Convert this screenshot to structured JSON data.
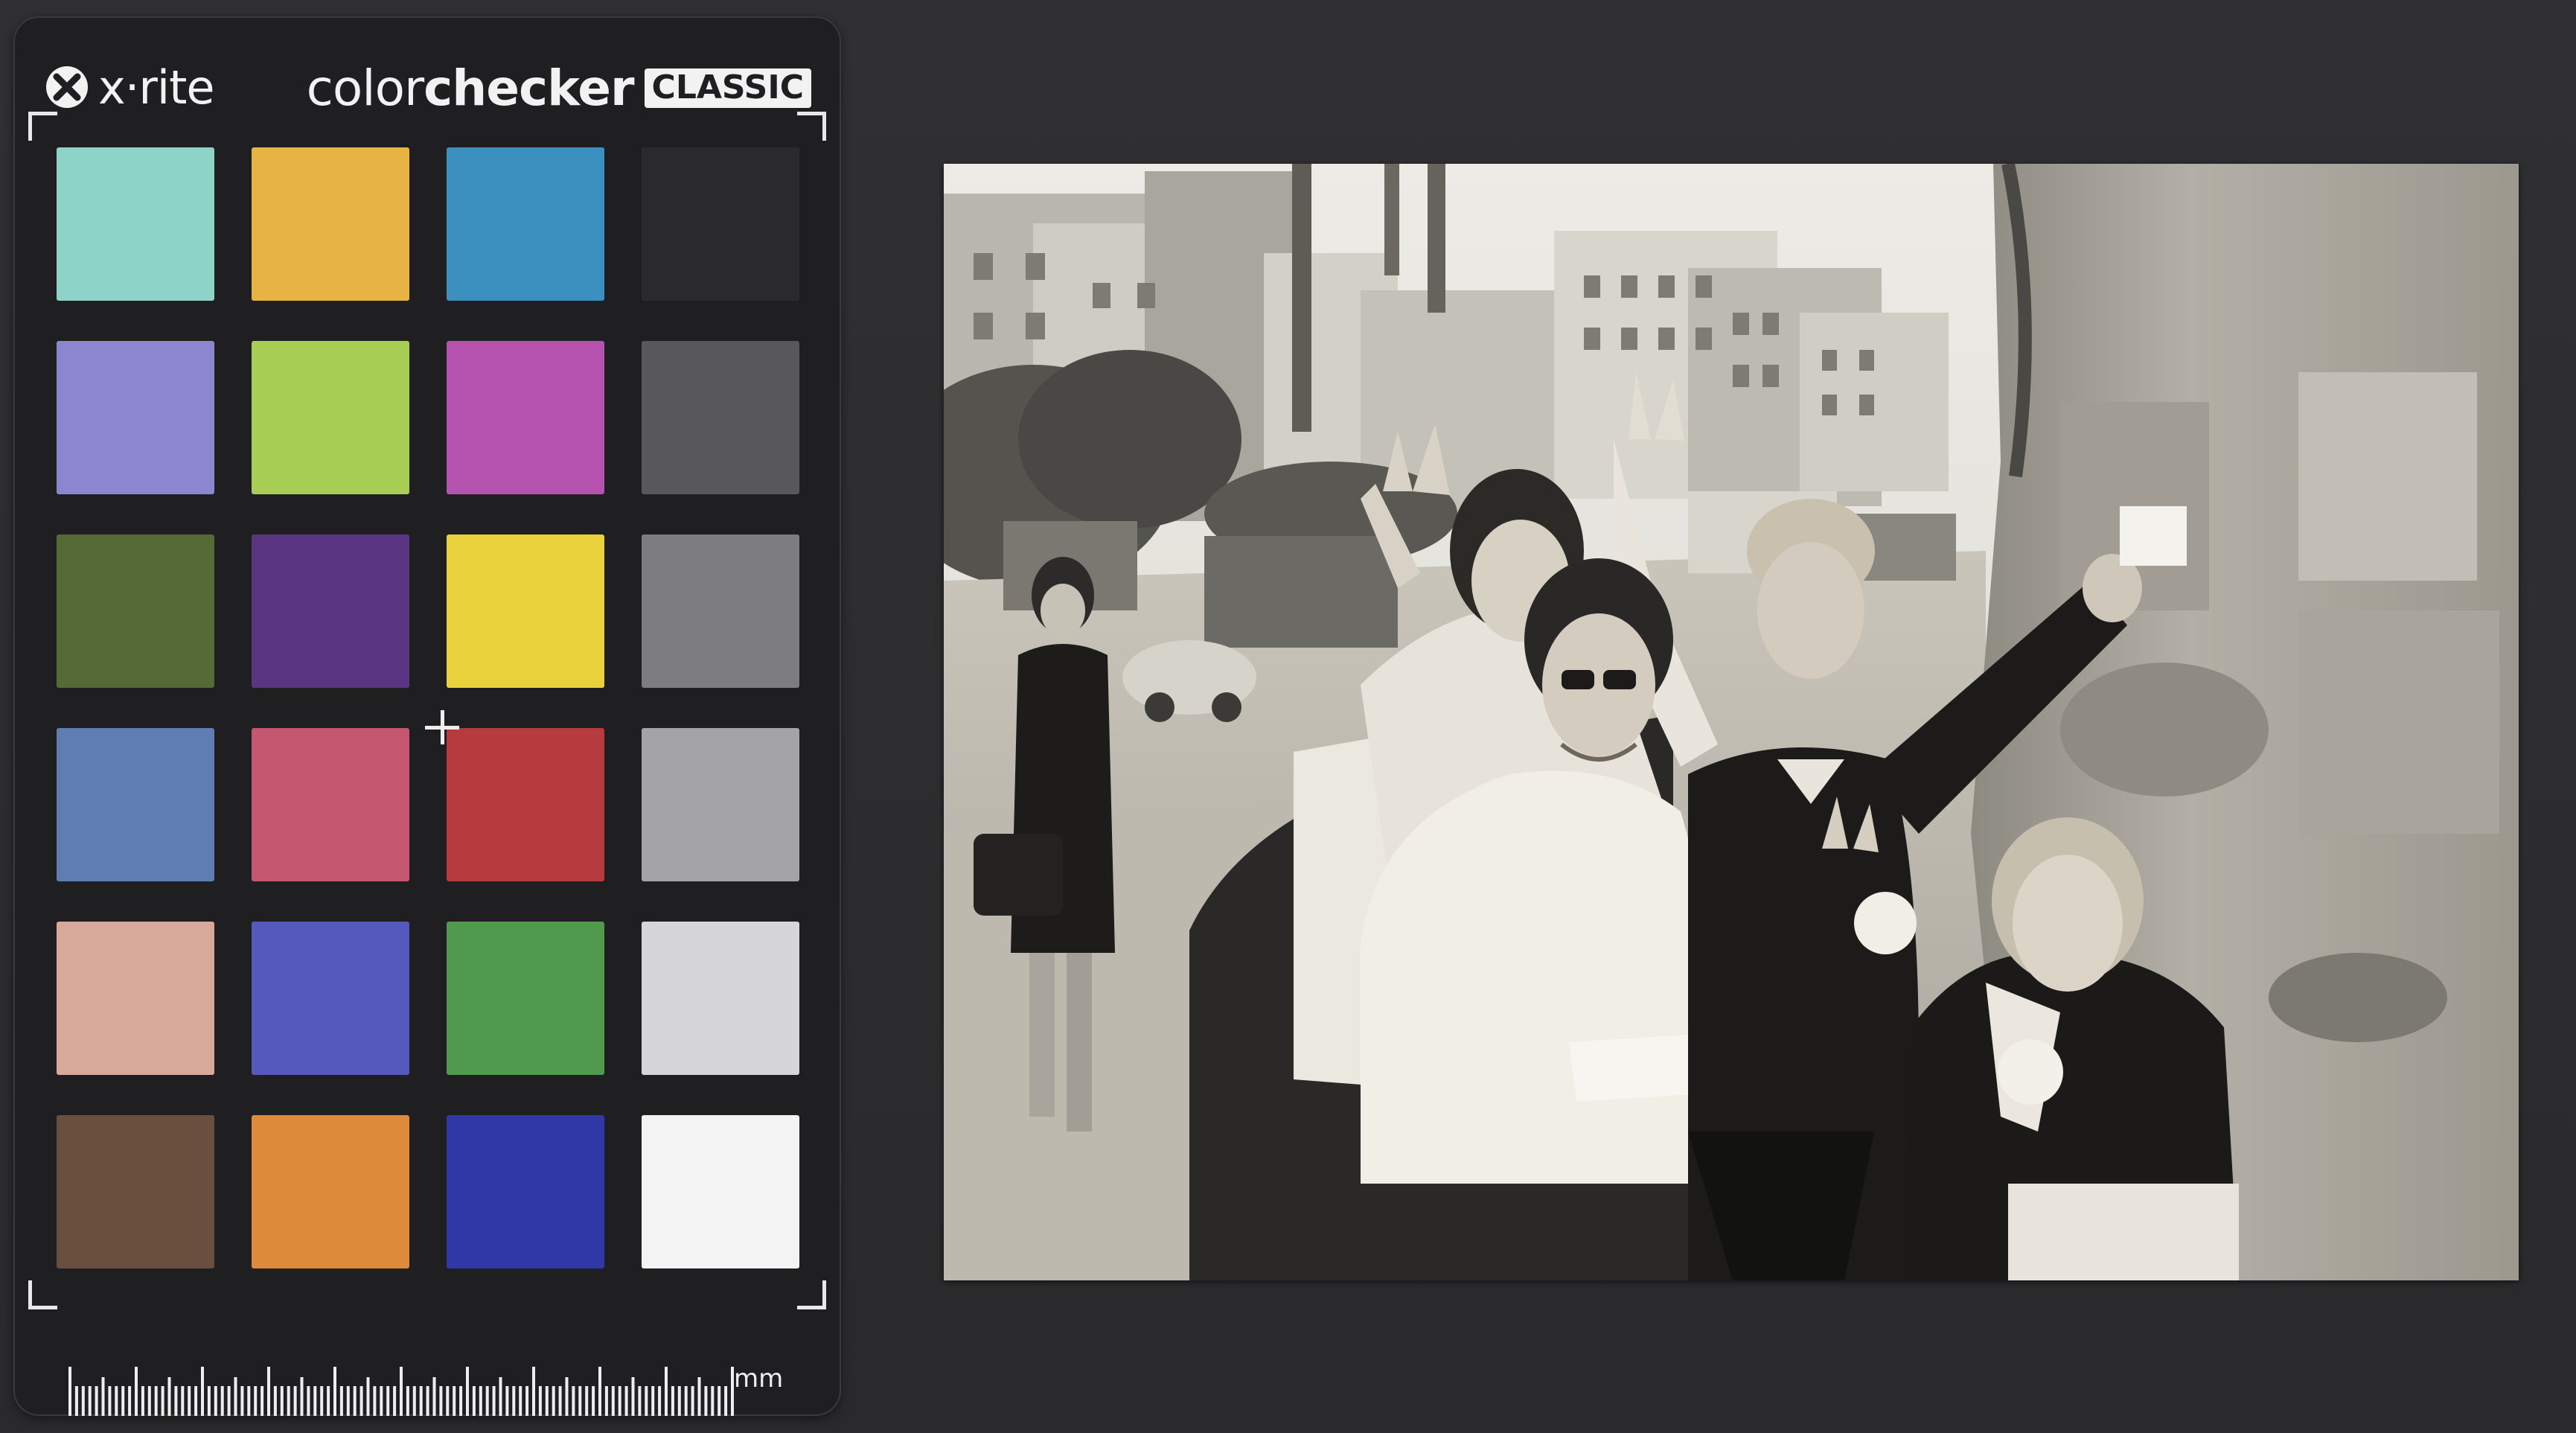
{
  "colorchecker": {
    "brand": "x·rite",
    "product_prefix": "color",
    "product_bold": "checker",
    "product_badge": "CLASSIC",
    "ruler_unit": "mm",
    "swatches": [
      "#8ed3c8",
      "#e7b443",
      "#3b90c0",
      "#2a2a2c",
      "#8c86d0",
      "#a8cd55",
      "#b552b0",
      "#58585a",
      "#556a35",
      "#5a3581",
      "#e9d23b",
      "#7d7d7f",
      "#5f7db0",
      "#c55670",
      "#b73a3f",
      "#a4a4a6",
      "#d6a99b",
      "#5559bd",
      "#4f9a4c",
      "#d6d6d8",
      "#6a4e3e",
      "#dd8a3b",
      "#2f38a6",
      "#f3f3f3"
    ]
  },
  "photo": {
    "description_icon": "group-portrait-photo"
  }
}
